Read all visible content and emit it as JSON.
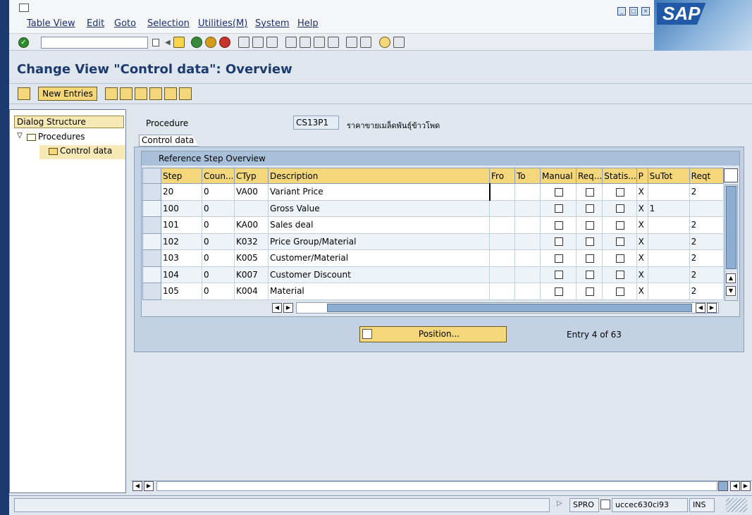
{
  "menubar": {
    "items": [
      "Table View",
      "Edit",
      "Goto",
      "Selection",
      "Utilities(M)",
      "System",
      "Help"
    ]
  },
  "brand": {
    "logo_text": "SAP"
  },
  "colors": {
    "accent": "#1c3a6d",
    "header_yellow": "#f3d77a",
    "panel_blue": "#c2d2e4"
  },
  "title": {
    "text": "Change View \"Control data\": Overview"
  },
  "app_toolbar": {
    "new_entries_label": "New Entries"
  },
  "dialog_structure": {
    "title": "Dialog Structure",
    "items": [
      {
        "label": "Procedures"
      },
      {
        "label": "Control data"
      }
    ]
  },
  "procedure": {
    "label": "Procedure",
    "value": "CS13P1",
    "description": "ราคาขายเมล็ดพันธุ์ข้าวโพด"
  },
  "tab": {
    "label": "Control data"
  },
  "grid": {
    "title": "Reference Step Overview",
    "columns": [
      "Step",
      "Coun...",
      "CTyp",
      "Description",
      "Fro",
      "To",
      "Manual",
      "Req...",
      "Statis...",
      "P",
      "SuTot",
      "Reqt"
    ],
    "rows": [
      {
        "step": "20",
        "coun": "0",
        "ctyp": "VA00",
        "desc": "Variant Price",
        "fro": "",
        "to": "",
        "p": "X",
        "sutot": "",
        "reqt": "2"
      },
      {
        "step": "100",
        "coun": "0",
        "ctyp": "",
        "desc": "Gross Value",
        "fro": "",
        "to": "",
        "p": "X",
        "sutot": "1",
        "reqt": ""
      },
      {
        "step": "101",
        "coun": "0",
        "ctyp": "KA00",
        "desc": "Sales deal",
        "fro": "",
        "to": "",
        "p": "X",
        "sutot": "",
        "reqt": "2"
      },
      {
        "step": "102",
        "coun": "0",
        "ctyp": "K032",
        "desc": "Price Group/Material",
        "fro": "",
        "to": "",
        "p": "X",
        "sutot": "",
        "reqt": "2"
      },
      {
        "step": "103",
        "coun": "0",
        "ctyp": "K005",
        "desc": "Customer/Material",
        "fro": "",
        "to": "",
        "p": "X",
        "sutot": "",
        "reqt": "2"
      },
      {
        "step": "104",
        "coun": "0",
        "ctyp": "K007",
        "desc": "Customer Discount",
        "fro": "",
        "to": "",
        "p": "X",
        "sutot": "",
        "reqt": "2"
      },
      {
        "step": "105",
        "coun": "0",
        "ctyp": "K004",
        "desc": "Material",
        "fro": "",
        "to": "",
        "p": "X",
        "sutot": "",
        "reqt": "2"
      }
    ]
  },
  "position": {
    "button_label": "Position...",
    "entry_info": "Entry 4 of 63"
  },
  "status": {
    "transaction": "SPRO",
    "server": "uccec630ci93",
    "mode": "INS"
  }
}
